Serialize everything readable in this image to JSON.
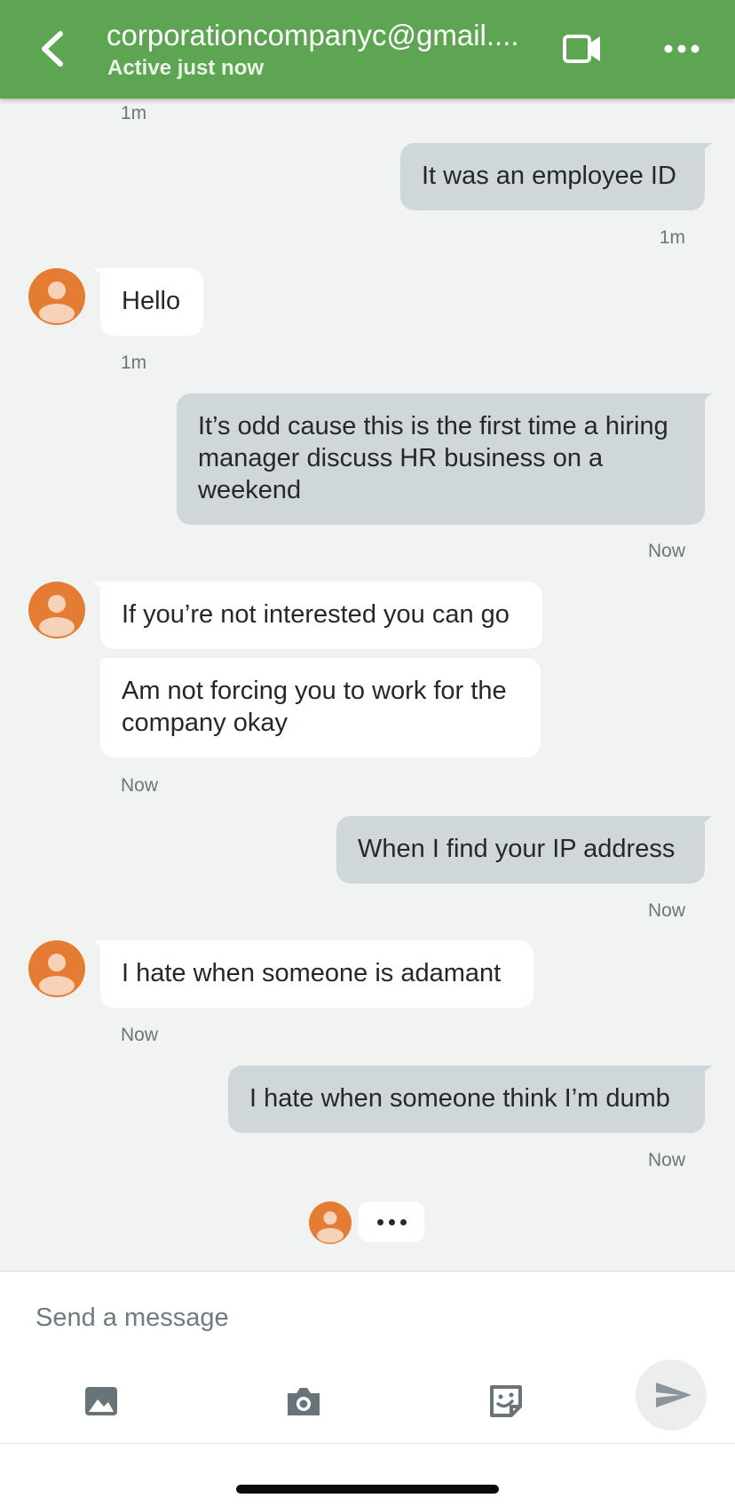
{
  "header": {
    "title": "corporationcompanyc@gmail....",
    "status": "Active just now",
    "icons": {
      "back": "chevron-left-icon",
      "video": "video-camera-icon",
      "more": "more-horizontal-icon"
    }
  },
  "colors": {
    "header": "#5da552",
    "outgoing_bubble": "#d0d7da",
    "incoming_bubble": "#ffffff",
    "avatar": "#e57c33",
    "background": "#f1f2f2"
  },
  "messages": [
    {
      "direction": "incoming",
      "timestamp": "1m"
    },
    {
      "direction": "outgoing",
      "text": "It was an employee ID",
      "timestamp": "1m"
    },
    {
      "direction": "incoming",
      "text": "Hello",
      "timestamp": "1m"
    },
    {
      "direction": "outgoing",
      "lines": [
        "It’s odd cause this is the first time a hiring",
        "manager discuss HR business on a",
        "weekend"
      ],
      "timestamp": "Now"
    },
    {
      "direction": "incoming",
      "text": "If you’re not interested you can go"
    },
    {
      "direction": "incoming",
      "lines": [
        "Am not forcing you to work for the",
        "company okay"
      ],
      "timestamp": "Now"
    },
    {
      "direction": "outgoing",
      "text": "When I find your IP address",
      "timestamp": "Now"
    },
    {
      "direction": "incoming",
      "text": "I hate when someone is adamant",
      "timestamp": "Now"
    },
    {
      "direction": "outgoing",
      "text": "I hate when someone think I’m dumb",
      "timestamp": "Now"
    }
  ],
  "typing_indicator": {
    "icon": "typing-dots-icon"
  },
  "composer": {
    "placeholder": "Send a message",
    "tools": [
      "image-icon",
      "camera-icon",
      "sticker-icon"
    ],
    "send_icon": "send-icon"
  }
}
